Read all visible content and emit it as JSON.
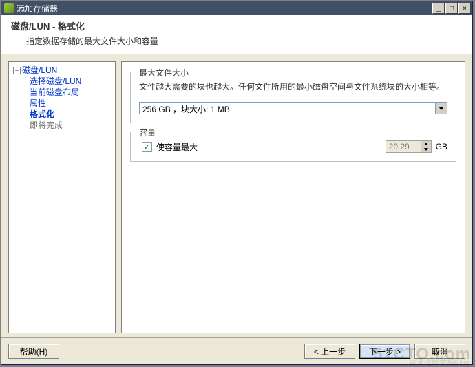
{
  "window": {
    "title": "添加存储器",
    "minimize_glyph": "_",
    "maximize_glyph": "□",
    "close_glyph": "×"
  },
  "header": {
    "title": "磁盘/LUN - 格式化",
    "subtitle": "指定数据存储的最大文件大小和容量"
  },
  "nav": {
    "tree_glyph": "−",
    "root": "磁盘/LUN",
    "items": [
      {
        "label": "选择磁盘/LUN"
      },
      {
        "label": "当前磁盘布局"
      },
      {
        "label": "属性"
      },
      {
        "label": "格式化"
      },
      {
        "label": "即将完成"
      }
    ]
  },
  "sections": {
    "max_file": {
      "legend": "最大文件大小",
      "desc": "文件越大需要的块也越大。任何文件所用的最小磁盘空间与文件系统块的大小相等。",
      "combo_value": "256 GB ，块大小: 1 MB"
    },
    "capacity": {
      "legend": "容量",
      "checkbox_label": "使容量最大",
      "checkbox_checked": true,
      "size_value": "29.29",
      "size_unit": "GB"
    }
  },
  "buttons": {
    "help": "帮助(H)",
    "back": "< 上一步",
    "next": "下一步 >",
    "cancel": "取消"
  },
  "watermark": {
    "line1": "51CTO.com",
    "line2": "技术成就梦想Blog"
  }
}
